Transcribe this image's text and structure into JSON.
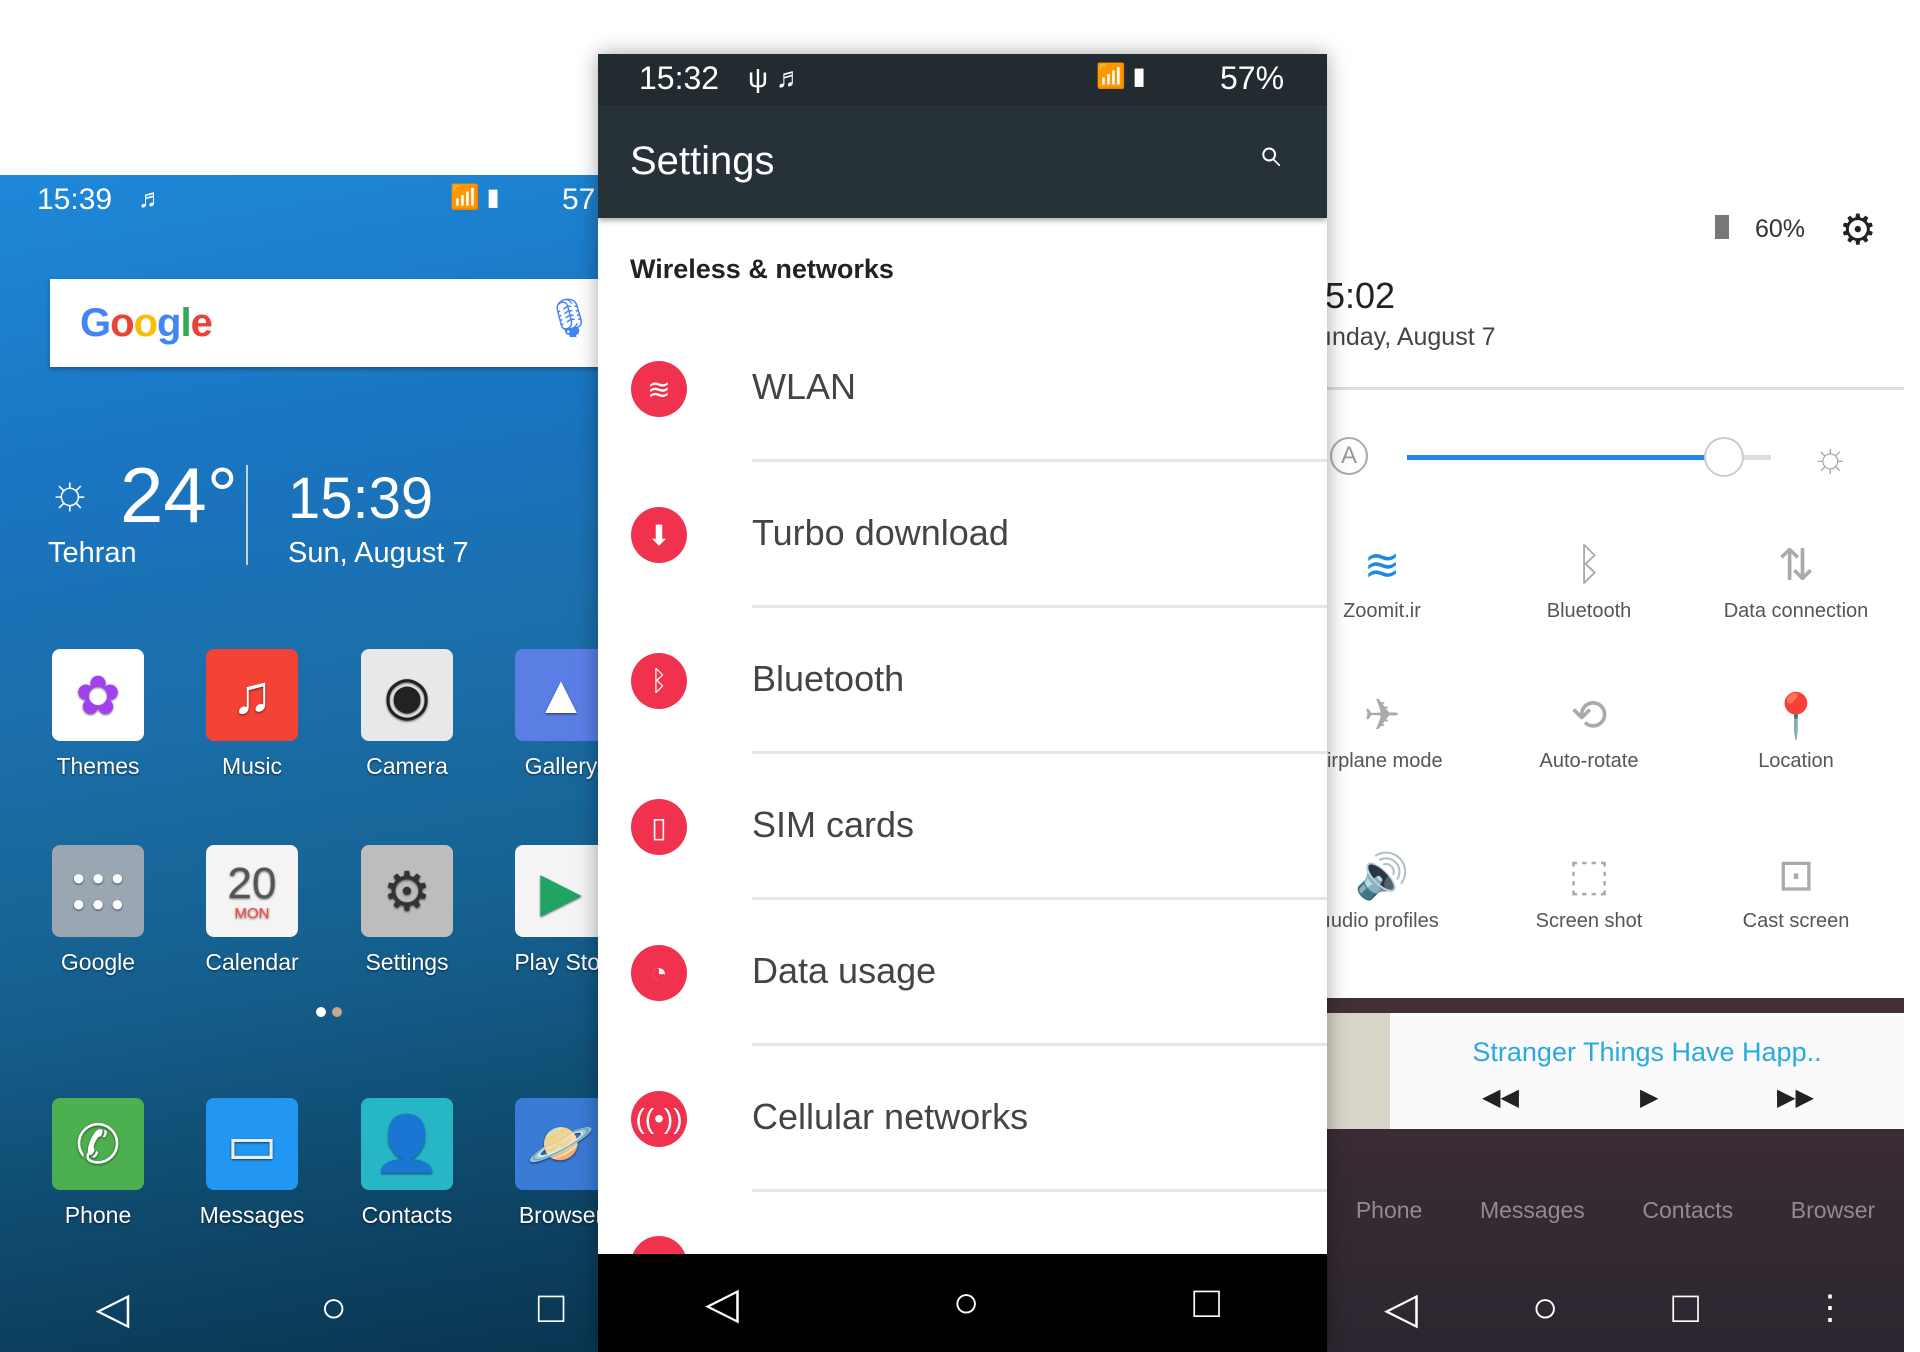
{
  "home": {
    "status": {
      "time": "15:39",
      "battery": "57"
    },
    "search": {
      "logo": "Google"
    },
    "weather": {
      "temp": "24°",
      "city": "Tehran",
      "time": "15:39",
      "date": "Sun, August 7"
    },
    "apps": [
      {
        "label": "Themes",
        "color": "#ffffff",
        "icon": "flower-icon"
      },
      {
        "label": "Music",
        "color": "#f44336",
        "icon": "music-note-icon"
      },
      {
        "label": "Camera",
        "color": "#e8e8e8",
        "icon": "camera-icon"
      },
      {
        "label": "Gallery",
        "color": "#5b7ee5",
        "icon": "gallery-icon"
      },
      {
        "label": "Google",
        "color": "#9aa7b3",
        "icon": "folder-icon"
      },
      {
        "label": "Calendar",
        "color": "#f4f4f4",
        "icon": "calendar-icon",
        "day": "20",
        "weekday": "MON"
      },
      {
        "label": "Settings",
        "color": "#bdbdbd",
        "icon": "gear-icon"
      },
      {
        "label": "Play Stor",
        "color": "#f4f4f4",
        "icon": "play-store-icon"
      }
    ],
    "dock": [
      {
        "label": "Phone",
        "color": "#4caf50"
      },
      {
        "label": "Messages",
        "color": "#2196f3"
      },
      {
        "label": "Contacts",
        "color": "#26b6c6"
      },
      {
        "label": "Browser",
        "color": "#3a7bd5"
      }
    ]
  },
  "settings": {
    "status": {
      "time": "15:32",
      "battery": "57%"
    },
    "title": "Settings",
    "section": "Wireless & networks",
    "accent": "#f0324f",
    "items": [
      {
        "label": "WLAN",
        "icon": "wifi-icon"
      },
      {
        "label": "Turbo download",
        "icon": "download-icon"
      },
      {
        "label": "Bluetooth",
        "icon": "bluetooth-icon"
      },
      {
        "label": "SIM cards",
        "icon": "sim-icon"
      },
      {
        "label": "Data usage",
        "icon": "data-usage-icon"
      },
      {
        "label": "Cellular networks",
        "icon": "cellular-icon"
      }
    ]
  },
  "shade": {
    "battery": "60%",
    "time": "5:02",
    "date": "ınday, August 7",
    "brightness": 0.87,
    "accent": "#1e88e5",
    "tiles": [
      {
        "label": "Zoomit.ir",
        "active": true,
        "icon": "wifi-icon"
      },
      {
        "label": "Bluetooth",
        "active": false,
        "icon": "bluetooth-icon"
      },
      {
        "label": "Data connection",
        "active": false,
        "icon": "data-connection-icon"
      },
      {
        "label": "ıirplane mode",
        "active": false,
        "icon": "airplane-icon"
      },
      {
        "label": "Auto-rotate",
        "active": false,
        "icon": "rotate-icon"
      },
      {
        "label": "Location",
        "active": true,
        "icon": "location-icon"
      },
      {
        "label": "ıudio profiles",
        "active": true,
        "icon": "speaker-icon"
      },
      {
        "label": "Screen shot",
        "active": false,
        "icon": "screenshot-icon"
      },
      {
        "label": "Cast screen",
        "active": false,
        "icon": "cast-icon"
      }
    ],
    "media": {
      "title": "Stranger Things Have Happ.."
    },
    "dock": [
      "Phone",
      "Messages",
      "Contacts",
      "Browser"
    ]
  }
}
